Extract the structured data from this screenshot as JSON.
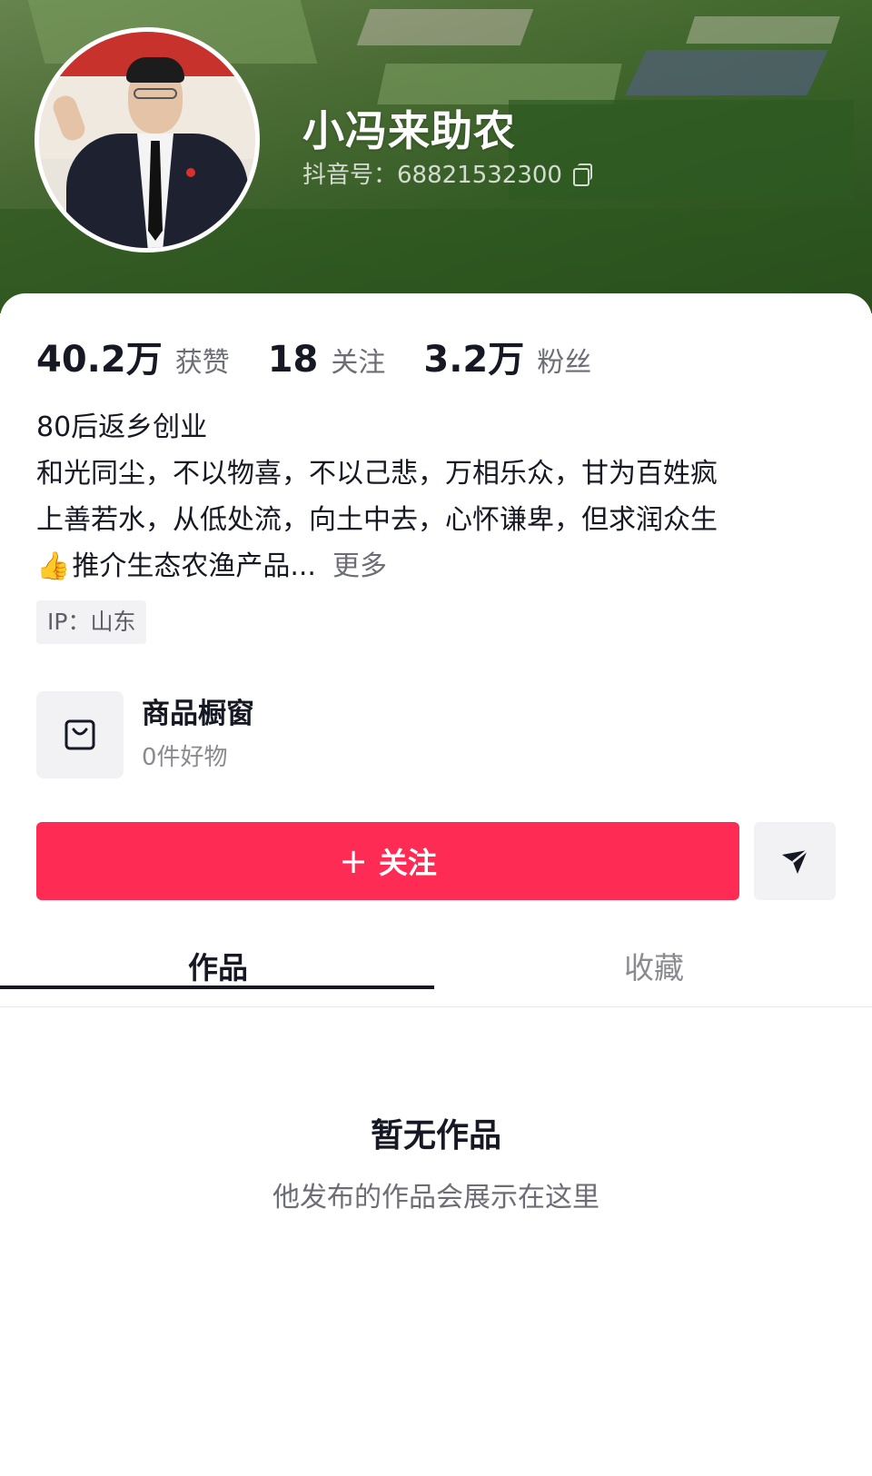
{
  "profile": {
    "nickname": "小冯来助农",
    "douyin_id": "抖音号：68821532300",
    "copy_icon": "copy-icon"
  },
  "stats": [
    {
      "value": "40.2万",
      "label": "获赞"
    },
    {
      "value": "18",
      "label": "关注"
    },
    {
      "value": "3.2万",
      "label": "粉丝"
    }
  ],
  "bio": {
    "line1": "80后返乡创业",
    "line2": "和光同尘，不以物喜，不以己悲，万相乐众，甘为百姓疯",
    "line3": "上善若水，从低处流，向土中去，心怀谦卑，但求润众生",
    "line4_emoji": "👍",
    "line4": "推介生态农渔产品...",
    "more": "更多"
  },
  "ip": "IP：山东",
  "shop": {
    "title": "商品橱窗",
    "subtitle": "0件好物",
    "icon": "shopping-bag-icon"
  },
  "actions": {
    "follow_icon": "+",
    "follow_label": "关注",
    "share_icon": "send-icon"
  },
  "tabs": [
    {
      "label": "作品",
      "active": true
    },
    {
      "label": "收藏",
      "active": false
    }
  ],
  "empty": {
    "title": "暂无作品",
    "subtitle": "他发布的作品会展示在这里"
  },
  "colors": {
    "accent": "#fe2c55",
    "text_primary": "#161823",
    "text_secondary": "#6d6e75"
  }
}
